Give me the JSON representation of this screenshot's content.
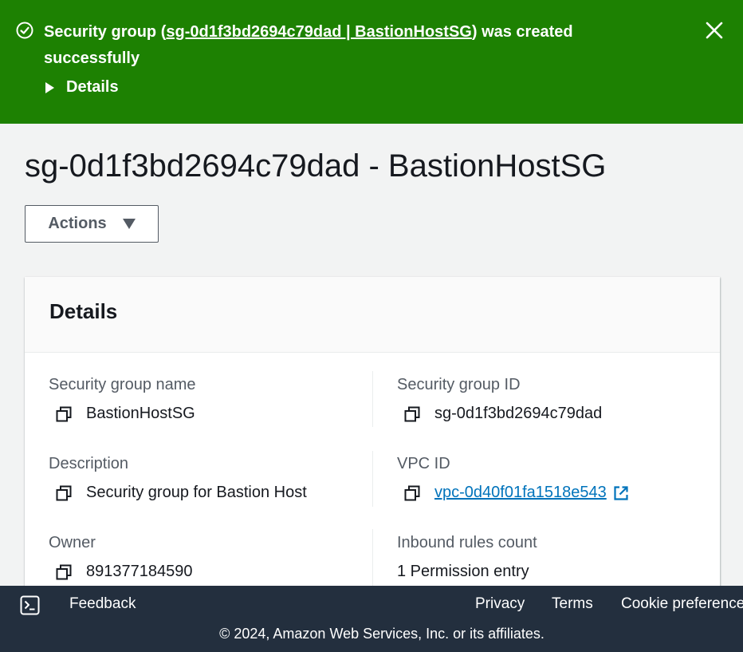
{
  "flash": {
    "message_prefix": "Security group (",
    "message_link": "sg-0d1f3bd2694c79dad | BastionHostSG",
    "message_suffix": ") was created successfully",
    "details_label": "Details",
    "color": "#1d8102"
  },
  "header": {
    "title": "sg-0d1f3bd2694c79dad - BastionHostSG",
    "actions_label": "Actions"
  },
  "details_panel": {
    "title": "Details",
    "fields": {
      "sg_name_label": "Security group name",
      "sg_name_value": "BastionHostSG",
      "sg_id_label": "Security group ID",
      "sg_id_value": "sg-0d1f3bd2694c79dad",
      "description_label": "Description",
      "description_value": "Security group for Bastion Host",
      "vpc_id_label": "VPC ID",
      "vpc_id_value": "vpc-0d40f01fa1518e543",
      "owner_label": "Owner",
      "owner_value": "891377184590",
      "inbound_label": "Inbound rules count",
      "inbound_value": "1 Permission entry"
    }
  },
  "footer": {
    "feedback": "Feedback",
    "privacy": "Privacy",
    "terms": "Terms",
    "cookie": "Cookie preferences",
    "copyright": "© 2024, Amazon Web Services, Inc. or its affiliates."
  },
  "icons": {
    "flash_status": "check-circle-icon",
    "flash_close": "close-icon",
    "copy": "copy-icon",
    "external": "external-link-icon",
    "shell": "cloudshell-icon"
  },
  "colors": {
    "link": "#0073bb",
    "footer_bg": "#232f3e"
  }
}
